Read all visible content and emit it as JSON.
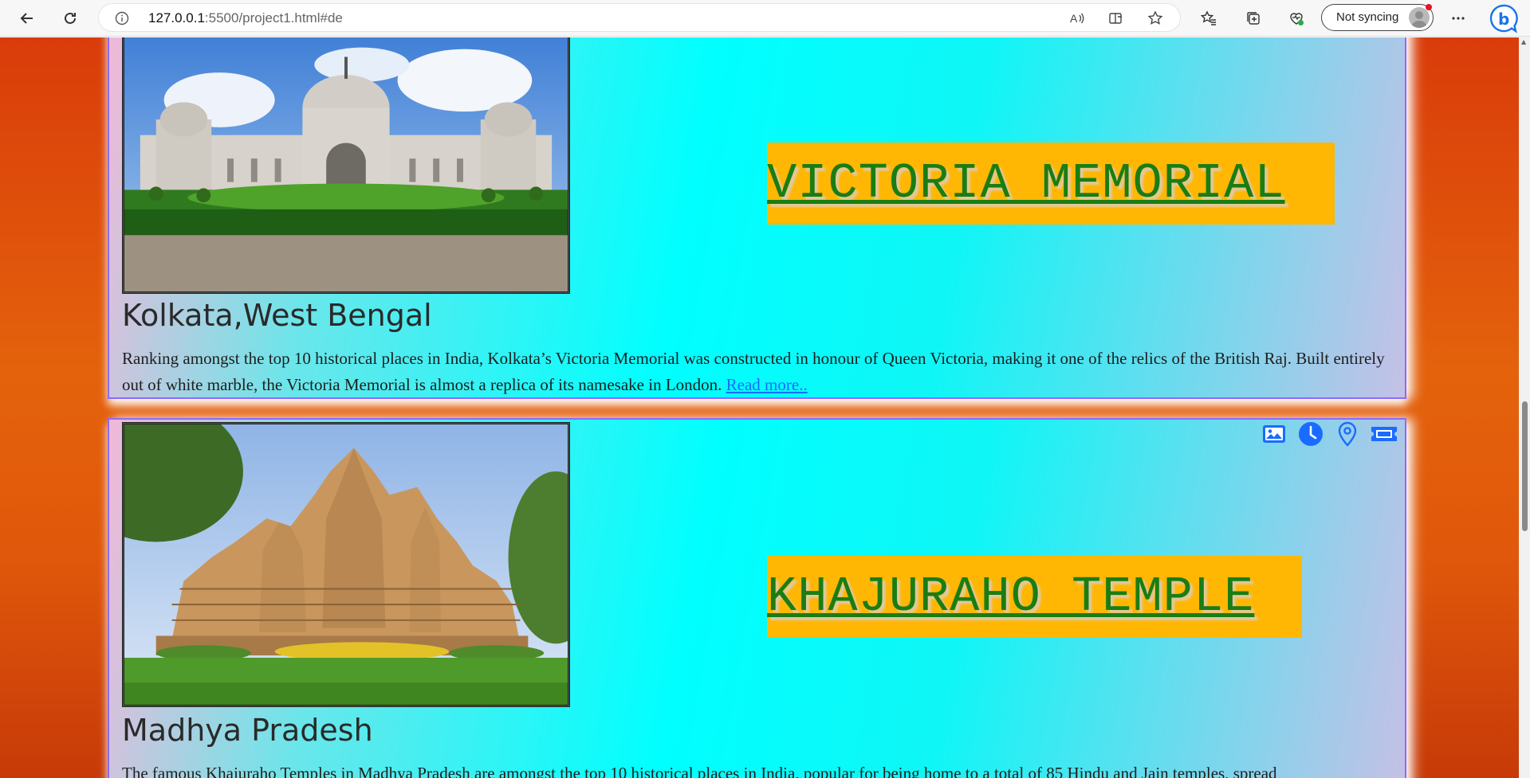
{
  "browser": {
    "url_host": "127.0.0.1",
    "url_path": ":5500/project1.html#de",
    "sync_label": "Not syncing",
    "icons": [
      "back-icon",
      "reload-icon",
      "site-info-icon",
      "read-aloud-icon",
      "immersive-reader-icon",
      "favorite-star-icon",
      "favorites-icon",
      "collections-icon",
      "browser-essentials-icon",
      "more-icon",
      "bing-copilot-icon"
    ]
  },
  "cards": [
    {
      "title": "VICTORIA MEMORIAL",
      "place": "Kolkata,West Bengal",
      "description": "Ranking amongst the top 10 historical places in India, Kolkata’s Victoria Memorial was constructed in honour of Queen Victoria, making it one of the relics of the British Raj. Built entirely out of white marble, the Victoria Memorial is almost a replica of its namesake in London.",
      "read_more": "Read more.."
    },
    {
      "title": "KHAJURAHO TEMPLE",
      "place": "Madhya Pradesh",
      "description": "The famous Khajuraho Temples in Madhya Pradesh are amongst the top 10 historical places in India, popular for being home to a total of 85 Hindu and Jain temples, spread",
      "icons": [
        "image-icon",
        "clock-icon",
        "location-pin-icon",
        "ticket-icon"
      ]
    }
  ],
  "colors": {
    "badge_bg": "#ffb703",
    "title_text": "#1a7d12",
    "link": "#1a6bff",
    "card_border": "#8a6bff"
  }
}
